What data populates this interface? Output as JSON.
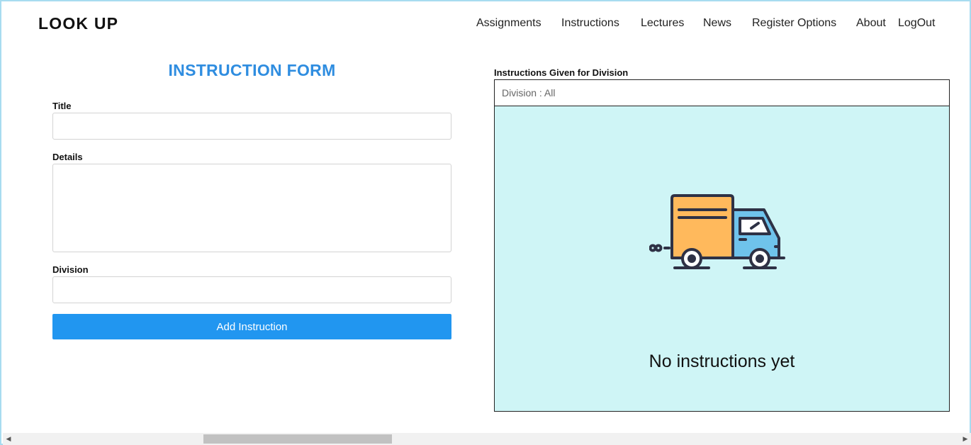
{
  "header": {
    "brand": "LOOK UP",
    "nav": [
      {
        "label": "Assignments"
      },
      {
        "label": "Instructions"
      },
      {
        "label": "Lectures"
      },
      {
        "label": "News"
      },
      {
        "label": "Register Options"
      },
      {
        "label": "About"
      },
      {
        "label": "LogOut"
      }
    ]
  },
  "form": {
    "title": "INSTRUCTION FORM",
    "title_label": "Title",
    "title_value": "",
    "details_label": "Details",
    "details_value": "",
    "division_label": "Division",
    "division_value": "",
    "submit_label": "Add Instruction"
  },
  "panel": {
    "heading": "Instructions Given for Division",
    "division_filter": "Division : All",
    "empty_message": "No instructions yet",
    "illustration": "delivery-truck-icon"
  },
  "colors": {
    "accent": "#2196f0",
    "form_title": "#2f8de0",
    "empty_bg": "#cff5f6",
    "truck_body": "#ffb95c",
    "truck_cab": "#6fc3eb",
    "truck_outline": "#2e3145"
  }
}
